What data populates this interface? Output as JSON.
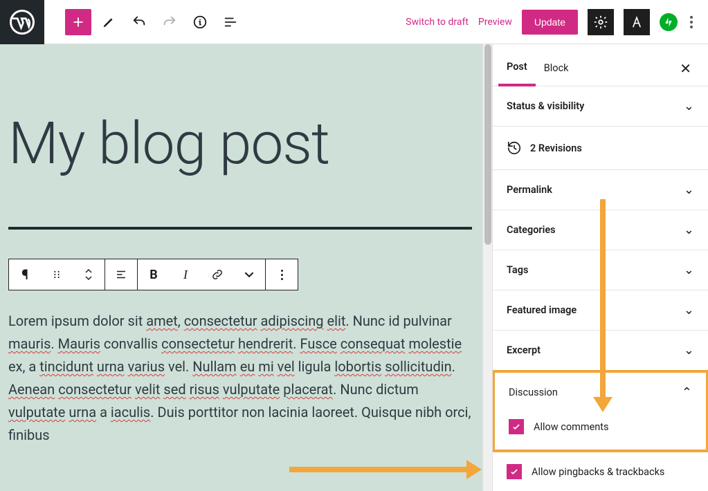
{
  "topbar": {
    "switch_draft": "Switch to draft",
    "preview": "Preview",
    "update": "Update"
  },
  "editor": {
    "title": "My blog post",
    "body_html": "Lorem ipsum dolor sit <u>amet</u>, <u>consectetur</u> <u>adipiscing</u> <u>elit</u>. Nunc id pulvinar <u>mauris</u>. <u>Mauris</u> convallis <u>consectetur</u> <u>hendrerit</u>. <u>Fusce</u> <u>consequat</u> <u>molestie</u> ex, a <u>tincidunt</u> <u>urna</u> <u>varius</u> vel. <u>Nullam</u> <u>eu</u> <u>mi</u> <u>vel</u> ligula <u>lobortis</u> <u>sollicitudin</u>. <u>Aenean</u> <u>consectetur</u> <u>velit</u> <u>sed</u> <u>risus</u> <u>vulputate</u> <u>placerat</u>. Nunc dictum <u>vulputate</u> <u>urna</u> a <u>iaculis</u>. Duis porttitor non lacinia laoreet. Quisque nibh orci, finibus"
  },
  "sidebar": {
    "tabs": {
      "post": "Post",
      "block": "Block"
    },
    "panels": {
      "status": "Status & visibility",
      "revisions": "2 Revisions",
      "permalink": "Permalink",
      "categories": "Categories",
      "tags": "Tags",
      "featured": "Featured image",
      "excerpt": "Excerpt",
      "discussion": "Discussion"
    },
    "discussion": {
      "allow_comments": "Allow comments",
      "allow_pingbacks": "Allow pingbacks & trackbacks"
    }
  },
  "colors": {
    "accent": "#d02a84",
    "annotate": "#f3a63a"
  }
}
